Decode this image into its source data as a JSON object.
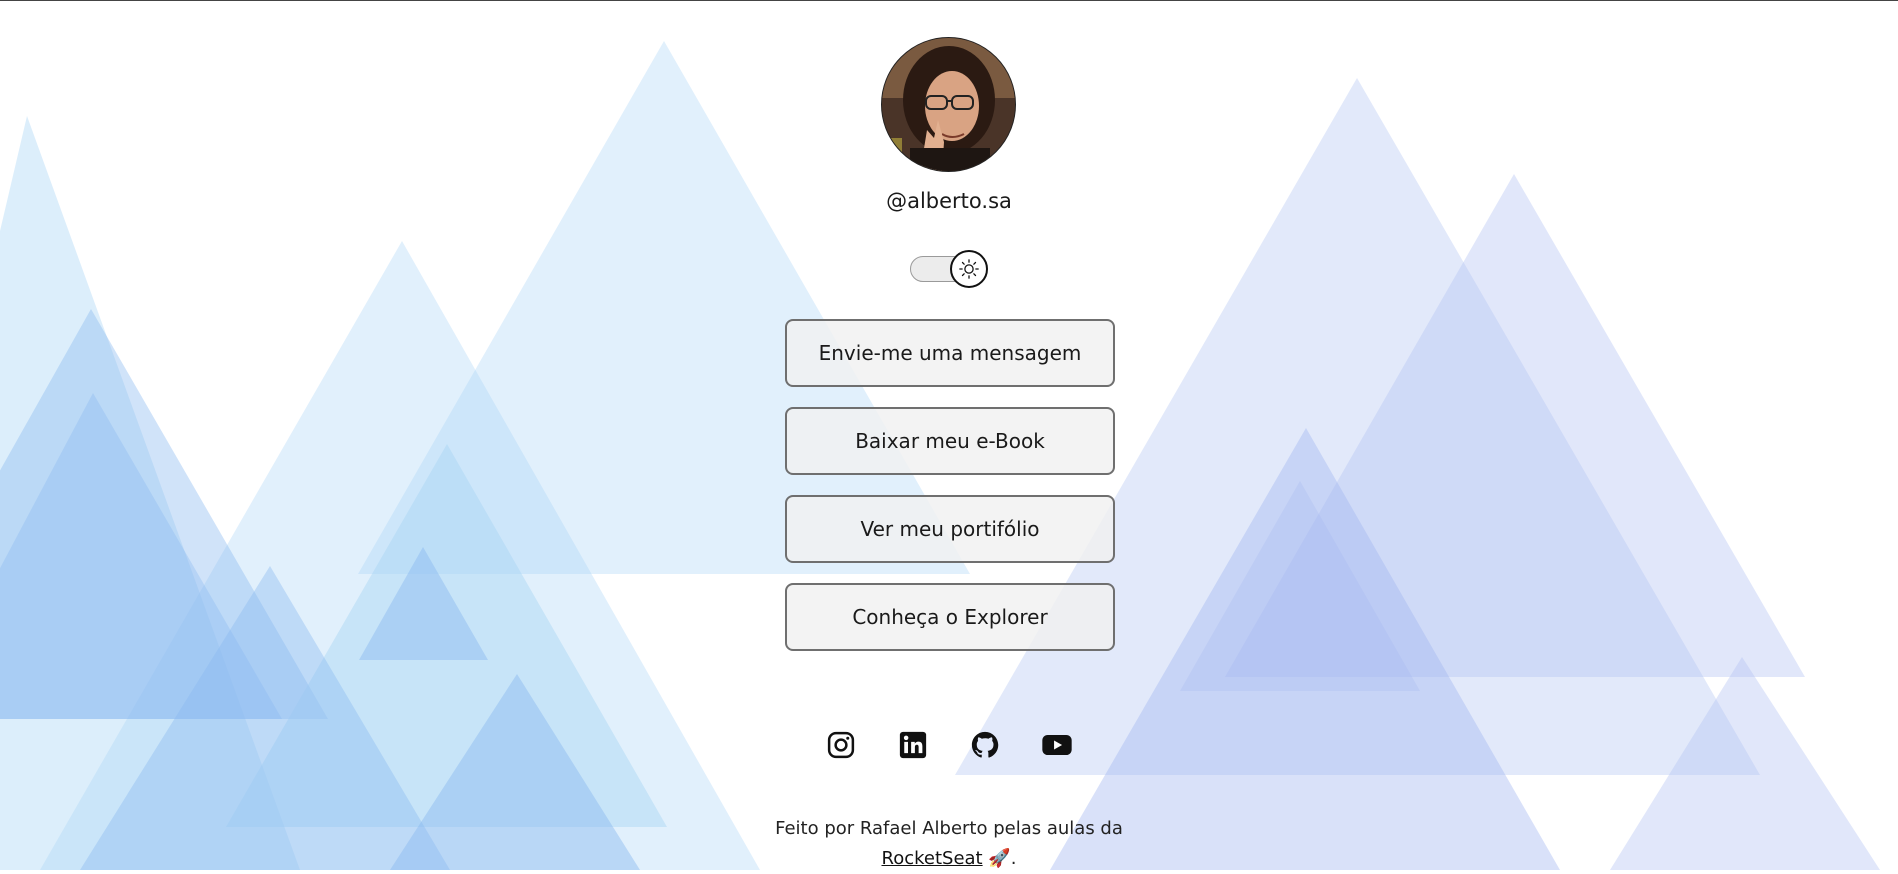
{
  "profile": {
    "handle": "@alberto.sa",
    "avatar_alt": "avatar"
  },
  "theme_toggle": {
    "state": "light",
    "icon": "sun-icon"
  },
  "links": [
    {
      "label": "Envie-me uma mensagem"
    },
    {
      "label": "Baixar meu e-Book"
    },
    {
      "label": "Ver meu portifólio"
    },
    {
      "label": "Conheça o Explorer"
    }
  ],
  "socials": [
    {
      "icon": "instagram-icon"
    },
    {
      "icon": "linkedin-icon"
    },
    {
      "icon": "github-icon"
    },
    {
      "icon": "youtube-icon"
    }
  ],
  "footer": {
    "text": "Feito por Rafael Alberto pelas aulas da",
    "link": "RocketSeat",
    "emoji": "🚀",
    "period": "."
  },
  "colors": {
    "background": "#ffffff",
    "triangle_light_blue": "#a8d4f5",
    "triangle_periwinkle": "#b4c4f2",
    "button_bg": "#f0f0f0",
    "button_border": "#6f6f6f"
  }
}
